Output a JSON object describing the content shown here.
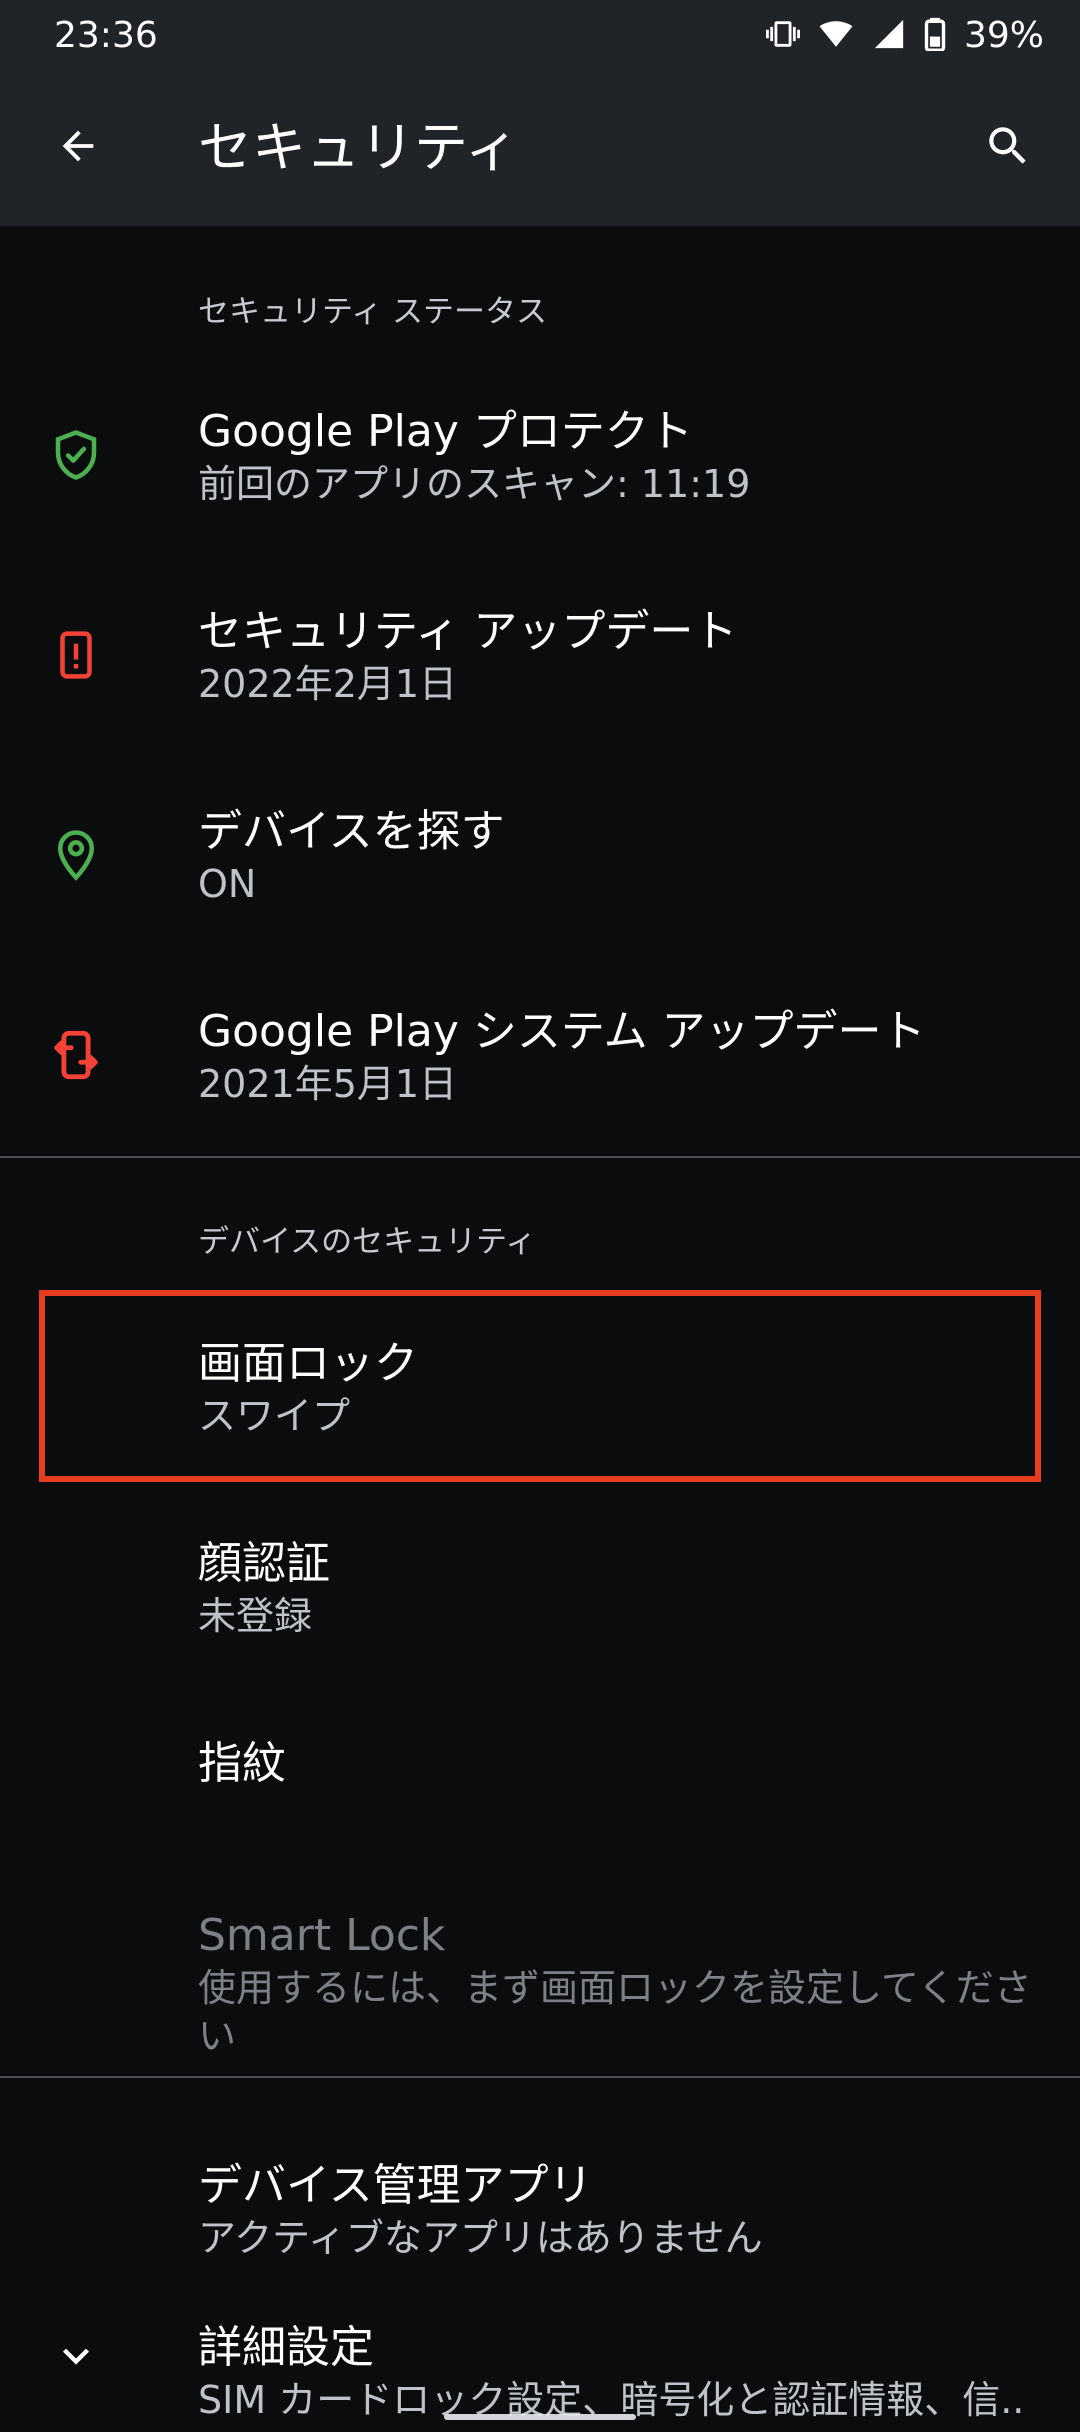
{
  "status_bar": {
    "time": "23:36",
    "battery": "39%",
    "icons": [
      "vibrate-icon",
      "wifi-icon",
      "signal-icon",
      "battery-icon"
    ]
  },
  "toolbar": {
    "title": "セキュリティ",
    "back_icon": "arrow-back-icon",
    "search_icon": "search-icon"
  },
  "sections": {
    "status": {
      "header": "セキュリティ ステータス",
      "items": [
        {
          "title": "Google Play プロテクト",
          "summary": "前回のアプリのスキャン: 11:19",
          "icon": "shield-check-icon",
          "icon_color": "#4caf50"
        },
        {
          "title": "セキュリティ アップデート",
          "summary": "2022年2月1日",
          "icon": "phone-alert-icon",
          "icon_color": "#f44336"
        },
        {
          "title": "デバイスを探す",
          "summary": "ON",
          "icon": "location-pin-icon",
          "icon_color": "#4caf50"
        },
        {
          "title": "Google Play システム アップデート",
          "summary": "2021年5月1日",
          "icon": "phone-update-icon",
          "icon_color": "#f44336"
        }
      ]
    },
    "device_security": {
      "header": "デバイスのセキュリティ",
      "items": [
        {
          "title": "画面ロック",
          "summary": "スワイプ"
        },
        {
          "title": "顔認証",
          "summary": "未登録"
        },
        {
          "title": "指紋"
        },
        {
          "title": "Smart Lock",
          "summary": "使用するには、まず画面ロックを設定してください",
          "disabled": true
        }
      ]
    },
    "admin": {
      "items": [
        {
          "title": "デバイス管理アプリ",
          "summary": "アクティブなアプリはありません"
        },
        {
          "title": "詳細設定",
          "summary": "SIM カードロック設定、暗号化と認証情報、信..",
          "icon": "chevron-down-icon"
        }
      ]
    }
  },
  "colors": {
    "toolbar_bg": "#202327",
    "page_bg": "#0b0c0e",
    "highlight": "#e53d1e",
    "green": "#4caf50",
    "red": "#f44336"
  }
}
